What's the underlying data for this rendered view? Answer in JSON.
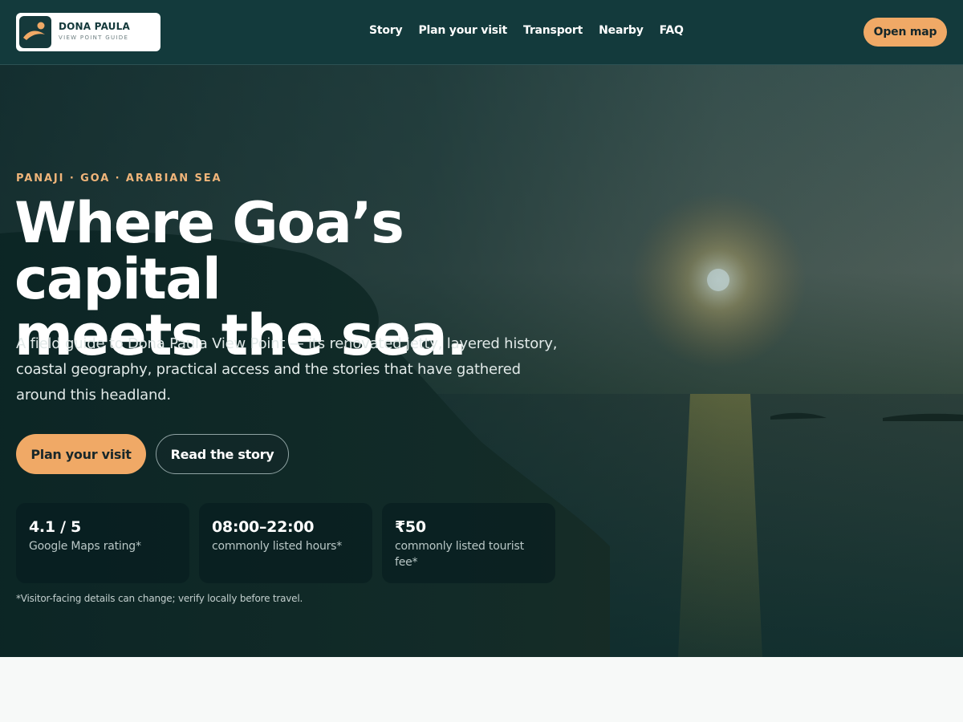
{
  "brand": {
    "title": "DONA PAULA",
    "subtitle": "VIEW POINT GUIDE",
    "logo_icon": "sunset-wave-icon"
  },
  "nav": {
    "items": [
      {
        "label": "Story"
      },
      {
        "label": "Plan your visit"
      },
      {
        "label": "Transport"
      },
      {
        "label": "Nearby"
      },
      {
        "label": "FAQ"
      }
    ],
    "cta_label": "Open map"
  },
  "hero": {
    "eyebrow": "PANAJI · GOA · ARABIAN SEA",
    "headline_line1": "Where Goa’s capital",
    "headline_line2": "meets the sea.",
    "lede": "A field guide to Dona Paula View Point — its renovated jetty, layered history, coastal geography, practical access and the stories that have gathered around this headland.",
    "primary_button": "Plan your visit",
    "secondary_button": "Read the story",
    "stats": [
      {
        "value": "4.1 / 5",
        "label": "Google Maps rating*"
      },
      {
        "value": "08:00–22:00",
        "label": "commonly listed hours*"
      },
      {
        "value": "₹50",
        "label": "commonly listed tourist fee*"
      }
    ],
    "disclaimer": "*Visitor-facing details can change; verify locally before travel."
  },
  "colors": {
    "header_bg": "#133a3c",
    "accent": "#f0a966",
    "eyebrow": "#f0b57a",
    "page_bg": "#f7f9f8"
  }
}
